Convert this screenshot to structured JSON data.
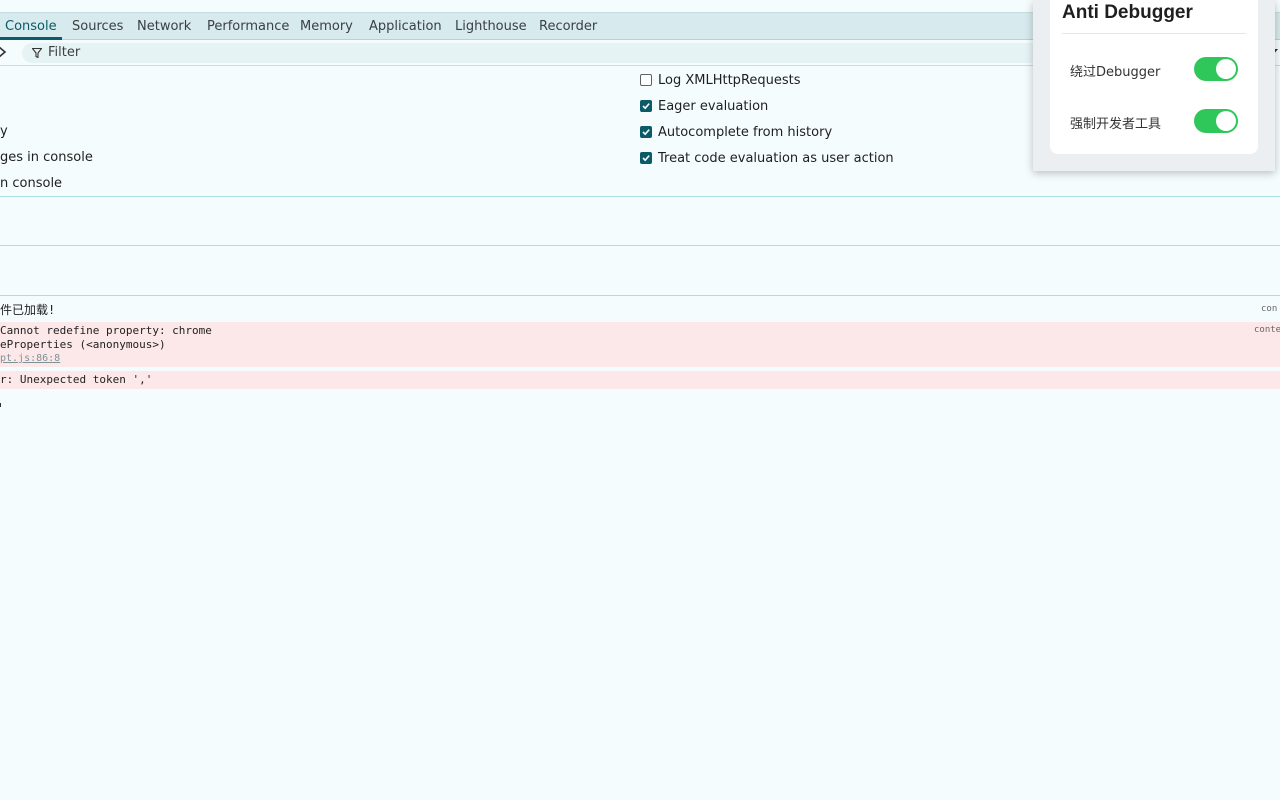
{
  "tabs": [
    {
      "label": "Console",
      "active": true
    },
    {
      "label": "Sources"
    },
    {
      "label": "Network"
    },
    {
      "label": "Performance"
    },
    {
      "label": "Memory"
    },
    {
      "label": "Application"
    },
    {
      "label": "Lighthouse"
    },
    {
      "label": "Recorder"
    }
  ],
  "filter": {
    "placeholder": "Filter"
  },
  "settings_left": [
    {
      "label": "y"
    },
    {
      "label": "ges in console"
    },
    {
      "label": "n console"
    }
  ],
  "settings_right": [
    {
      "label": "Log XMLHttpRequests",
      "checked": false
    },
    {
      "label": "Eager evaluation",
      "checked": true
    },
    {
      "label": "Autocomplete from history",
      "checked": true
    },
    {
      "label": "Treat code evaluation as user action",
      "checked": true
    }
  ],
  "console": {
    "info_text": "件已加载!",
    "info_source": "con",
    "error1_line1": " Cannot redefine property: chrome",
    "error1_line2": "eProperties (<anonymous>)",
    "error1_link": "pt.js:86:8",
    "error1_source": "conte",
    "error2_line1": "r: Unexpected token ','"
  },
  "popup": {
    "title": "Anti Debugger",
    "toggles": [
      {
        "label": "绕过Debugger",
        "on": true
      },
      {
        "label": "强制开发者工具",
        "on": true
      }
    ]
  },
  "colors": {
    "accent": "#0b5b68",
    "toggle_on": "#2fc65a",
    "error_bg": "#fce8e9"
  }
}
